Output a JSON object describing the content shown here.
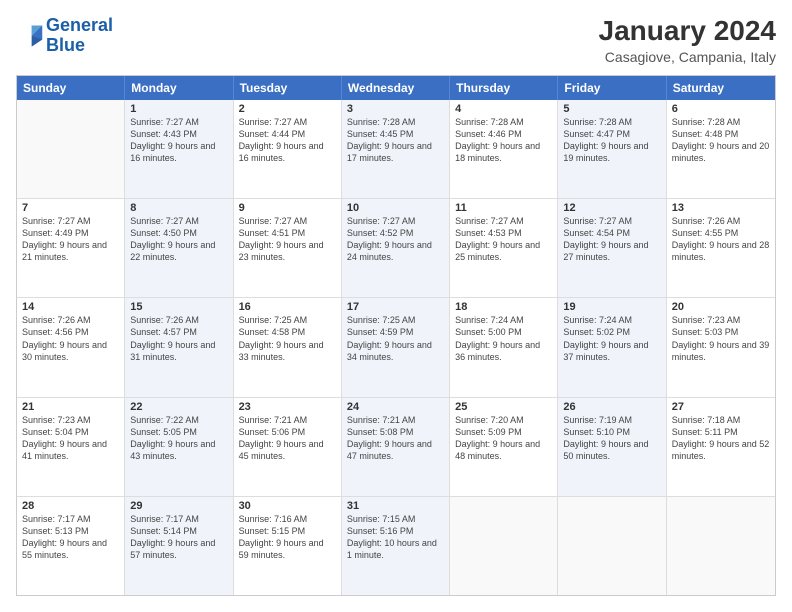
{
  "header": {
    "logo_line1": "General",
    "logo_line2": "Blue",
    "title": "January 2024",
    "subtitle": "Casagiove, Campania, Italy"
  },
  "columns": [
    "Sunday",
    "Monday",
    "Tuesday",
    "Wednesday",
    "Thursday",
    "Friday",
    "Saturday"
  ],
  "weeks": [
    [
      {
        "num": "",
        "sunrise": "",
        "sunset": "",
        "daylight": "",
        "shaded": false,
        "empty": true
      },
      {
        "num": "1",
        "sunrise": "Sunrise: 7:27 AM",
        "sunset": "Sunset: 4:43 PM",
        "daylight": "Daylight: 9 hours and 16 minutes.",
        "shaded": true
      },
      {
        "num": "2",
        "sunrise": "Sunrise: 7:27 AM",
        "sunset": "Sunset: 4:44 PM",
        "daylight": "Daylight: 9 hours and 16 minutes.",
        "shaded": false
      },
      {
        "num": "3",
        "sunrise": "Sunrise: 7:28 AM",
        "sunset": "Sunset: 4:45 PM",
        "daylight": "Daylight: 9 hours and 17 minutes.",
        "shaded": true
      },
      {
        "num": "4",
        "sunrise": "Sunrise: 7:28 AM",
        "sunset": "Sunset: 4:46 PM",
        "daylight": "Daylight: 9 hours and 18 minutes.",
        "shaded": false
      },
      {
        "num": "5",
        "sunrise": "Sunrise: 7:28 AM",
        "sunset": "Sunset: 4:47 PM",
        "daylight": "Daylight: 9 hours and 19 minutes.",
        "shaded": true
      },
      {
        "num": "6",
        "sunrise": "Sunrise: 7:28 AM",
        "sunset": "Sunset: 4:48 PM",
        "daylight": "Daylight: 9 hours and 20 minutes.",
        "shaded": false
      }
    ],
    [
      {
        "num": "7",
        "sunrise": "Sunrise: 7:27 AM",
        "sunset": "Sunset: 4:49 PM",
        "daylight": "Daylight: 9 hours and 21 minutes.",
        "shaded": false
      },
      {
        "num": "8",
        "sunrise": "Sunrise: 7:27 AM",
        "sunset": "Sunset: 4:50 PM",
        "daylight": "Daylight: 9 hours and 22 minutes.",
        "shaded": true
      },
      {
        "num": "9",
        "sunrise": "Sunrise: 7:27 AM",
        "sunset": "Sunset: 4:51 PM",
        "daylight": "Daylight: 9 hours and 23 minutes.",
        "shaded": false
      },
      {
        "num": "10",
        "sunrise": "Sunrise: 7:27 AM",
        "sunset": "Sunset: 4:52 PM",
        "daylight": "Daylight: 9 hours and 24 minutes.",
        "shaded": true
      },
      {
        "num": "11",
        "sunrise": "Sunrise: 7:27 AM",
        "sunset": "Sunset: 4:53 PM",
        "daylight": "Daylight: 9 hours and 25 minutes.",
        "shaded": false
      },
      {
        "num": "12",
        "sunrise": "Sunrise: 7:27 AM",
        "sunset": "Sunset: 4:54 PM",
        "daylight": "Daylight: 9 hours and 27 minutes.",
        "shaded": true
      },
      {
        "num": "13",
        "sunrise": "Sunrise: 7:26 AM",
        "sunset": "Sunset: 4:55 PM",
        "daylight": "Daylight: 9 hours and 28 minutes.",
        "shaded": false
      }
    ],
    [
      {
        "num": "14",
        "sunrise": "Sunrise: 7:26 AM",
        "sunset": "Sunset: 4:56 PM",
        "daylight": "Daylight: 9 hours and 30 minutes.",
        "shaded": false
      },
      {
        "num": "15",
        "sunrise": "Sunrise: 7:26 AM",
        "sunset": "Sunset: 4:57 PM",
        "daylight": "Daylight: 9 hours and 31 minutes.",
        "shaded": true
      },
      {
        "num": "16",
        "sunrise": "Sunrise: 7:25 AM",
        "sunset": "Sunset: 4:58 PM",
        "daylight": "Daylight: 9 hours and 33 minutes.",
        "shaded": false
      },
      {
        "num": "17",
        "sunrise": "Sunrise: 7:25 AM",
        "sunset": "Sunset: 4:59 PM",
        "daylight": "Daylight: 9 hours and 34 minutes.",
        "shaded": true
      },
      {
        "num": "18",
        "sunrise": "Sunrise: 7:24 AM",
        "sunset": "Sunset: 5:00 PM",
        "daylight": "Daylight: 9 hours and 36 minutes.",
        "shaded": false
      },
      {
        "num": "19",
        "sunrise": "Sunrise: 7:24 AM",
        "sunset": "Sunset: 5:02 PM",
        "daylight": "Daylight: 9 hours and 37 minutes.",
        "shaded": true
      },
      {
        "num": "20",
        "sunrise": "Sunrise: 7:23 AM",
        "sunset": "Sunset: 5:03 PM",
        "daylight": "Daylight: 9 hours and 39 minutes.",
        "shaded": false
      }
    ],
    [
      {
        "num": "21",
        "sunrise": "Sunrise: 7:23 AM",
        "sunset": "Sunset: 5:04 PM",
        "daylight": "Daylight: 9 hours and 41 minutes.",
        "shaded": false
      },
      {
        "num": "22",
        "sunrise": "Sunrise: 7:22 AM",
        "sunset": "Sunset: 5:05 PM",
        "daylight": "Daylight: 9 hours and 43 minutes.",
        "shaded": true
      },
      {
        "num": "23",
        "sunrise": "Sunrise: 7:21 AM",
        "sunset": "Sunset: 5:06 PM",
        "daylight": "Daylight: 9 hours and 45 minutes.",
        "shaded": false
      },
      {
        "num": "24",
        "sunrise": "Sunrise: 7:21 AM",
        "sunset": "Sunset: 5:08 PM",
        "daylight": "Daylight: 9 hours and 47 minutes.",
        "shaded": true
      },
      {
        "num": "25",
        "sunrise": "Sunrise: 7:20 AM",
        "sunset": "Sunset: 5:09 PM",
        "daylight": "Daylight: 9 hours and 48 minutes.",
        "shaded": false
      },
      {
        "num": "26",
        "sunrise": "Sunrise: 7:19 AM",
        "sunset": "Sunset: 5:10 PM",
        "daylight": "Daylight: 9 hours and 50 minutes.",
        "shaded": true
      },
      {
        "num": "27",
        "sunrise": "Sunrise: 7:18 AM",
        "sunset": "Sunset: 5:11 PM",
        "daylight": "Daylight: 9 hours and 52 minutes.",
        "shaded": false
      }
    ],
    [
      {
        "num": "28",
        "sunrise": "Sunrise: 7:17 AM",
        "sunset": "Sunset: 5:13 PM",
        "daylight": "Daylight: 9 hours and 55 minutes.",
        "shaded": false
      },
      {
        "num": "29",
        "sunrise": "Sunrise: 7:17 AM",
        "sunset": "Sunset: 5:14 PM",
        "daylight": "Daylight: 9 hours and 57 minutes.",
        "shaded": true
      },
      {
        "num": "30",
        "sunrise": "Sunrise: 7:16 AM",
        "sunset": "Sunset: 5:15 PM",
        "daylight": "Daylight: 9 hours and 59 minutes.",
        "shaded": false
      },
      {
        "num": "31",
        "sunrise": "Sunrise: 7:15 AM",
        "sunset": "Sunset: 5:16 PM",
        "daylight": "Daylight: 10 hours and 1 minute.",
        "shaded": true
      },
      {
        "num": "",
        "sunrise": "",
        "sunset": "",
        "daylight": "",
        "shaded": false,
        "empty": true
      },
      {
        "num": "",
        "sunrise": "",
        "sunset": "",
        "daylight": "",
        "shaded": false,
        "empty": true
      },
      {
        "num": "",
        "sunrise": "",
        "sunset": "",
        "daylight": "",
        "shaded": false,
        "empty": true
      }
    ]
  ]
}
